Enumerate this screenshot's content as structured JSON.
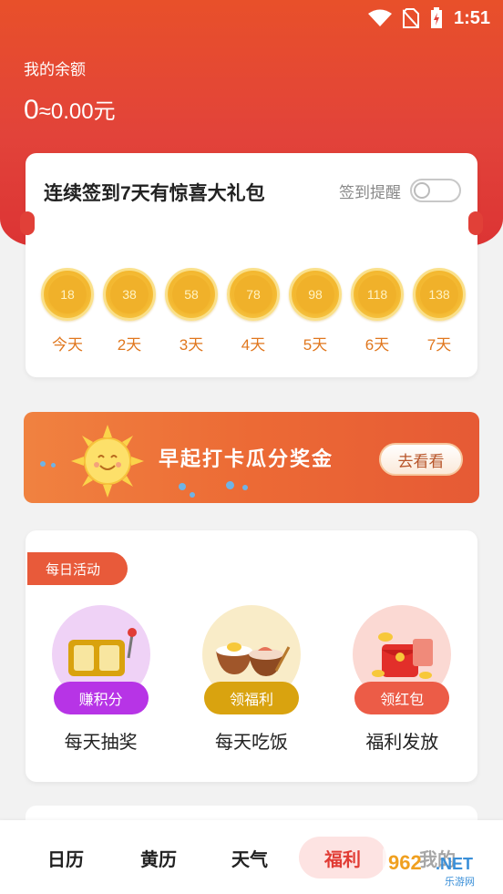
{
  "status": {
    "time": "1:51"
  },
  "balance": {
    "label": "我的余额",
    "points": "0",
    "approx": "≈0.00元"
  },
  "checkin": {
    "title": "连续签到7天有惊喜大礼包",
    "reminder_label": "签到提醒",
    "reminder_on": false,
    "days": [
      {
        "coins": "18",
        "label": "今天"
      },
      {
        "coins": "38",
        "label": "2天"
      },
      {
        "coins": "58",
        "label": "3天"
      },
      {
        "coins": "78",
        "label": "4天"
      },
      {
        "coins": "98",
        "label": "5天"
      },
      {
        "coins": "118",
        "label": "6天"
      },
      {
        "coins": "138",
        "label": "7天"
      }
    ]
  },
  "banner": {
    "text": "早起打卡瓜分奖金",
    "button": "去看看"
  },
  "activity": {
    "tag": "每日活动",
    "items": [
      {
        "button": "赚积分",
        "label": "每天抽奖",
        "icon": "slot-machine-icon",
        "color": "#b734e6",
        "bg": "#efd2f6"
      },
      {
        "button": "领福利",
        "label": "每天吃饭",
        "icon": "meal-bowls-icon",
        "color": "#d9a30f",
        "bg": "#f9ecc8"
      },
      {
        "button": "领红包",
        "label": "福利发放",
        "icon": "red-envelope-icon",
        "color": "#ec5c47",
        "bg": "#fbd9d3"
      }
    ]
  },
  "tabs": [
    {
      "label": "日历",
      "active": false
    },
    {
      "label": "黄历",
      "active": false
    },
    {
      "label": "天气",
      "active": false
    },
    {
      "label": "福利",
      "active": true
    },
    {
      "label": "我的",
      "active": false
    }
  ],
  "watermark": {
    "text": "962.NET",
    "sub": "乐游网"
  },
  "colors": {
    "header": "#e2433a",
    "accent": "#e13c35",
    "coin": "#f3b72f"
  }
}
